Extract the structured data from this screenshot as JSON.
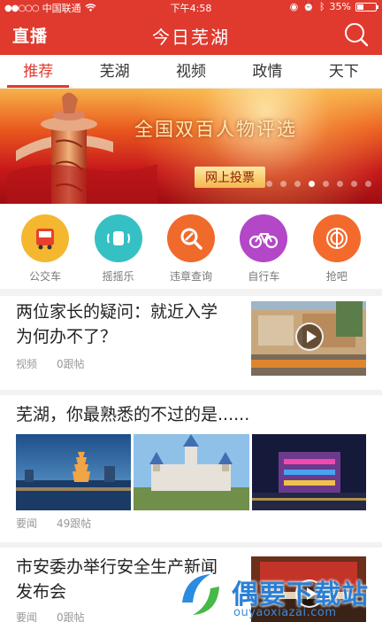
{
  "status_bar": {
    "carrier": "中国联通",
    "time": "下午4:58",
    "battery": "35%",
    "battery_level": 0.35
  },
  "header": {
    "live_label": "直播",
    "title": "今日芜湖",
    "search_icon": "search-icon"
  },
  "tabs": [
    {
      "label": "推荐",
      "active": true
    },
    {
      "label": "芜湖",
      "active": false
    },
    {
      "label": "视频",
      "active": false
    },
    {
      "label": "政情",
      "active": false
    },
    {
      "label": "天下",
      "active": false
    }
  ],
  "banner": {
    "headline": "全国双百人物评选",
    "vote_label": "网上投票",
    "slide_count": 8,
    "active_slide": 3
  },
  "services": [
    {
      "label": "公交车",
      "icon": "bus-icon",
      "color": "#f4b72f"
    },
    {
      "label": "摇摇乐",
      "icon": "shake-hand-icon",
      "color": "#35c1c4"
    },
    {
      "label": "违章查询",
      "icon": "violation-search-icon",
      "color": "#f06a2b"
    },
    {
      "label": "自行车",
      "icon": "bicycle-icon",
      "color": "#b347c7"
    },
    {
      "label": "抢吧",
      "icon": "grab-icon",
      "color": "#f36a2c"
    }
  ],
  "news": [
    {
      "title_line1": "两位家长的疑问：就近入学",
      "title_line2": "为何办不了？",
      "category": "视频",
      "comments": "0跟帖"
    },
    {
      "title": "芜湖，你最熟悉的不过的是......",
      "category": "要闻",
      "comments": "49跟帖"
    },
    {
      "title_line1": "市安委办举行安全生产新闻",
      "title_line2": "发布会",
      "category": "要闻",
      "comments": "0跟帖"
    }
  ],
  "watermark": {
    "text": "偶要下载站",
    "url": "ouyaoxiazai.com"
  },
  "colors": {
    "brand_red": "#e03a2f"
  }
}
